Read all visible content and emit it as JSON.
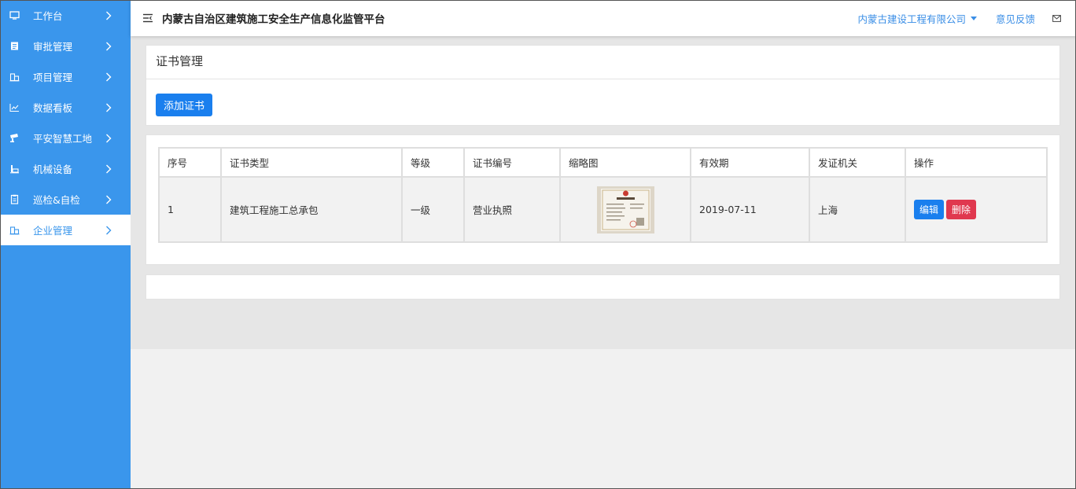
{
  "header": {
    "title": "内蒙古自治区建筑施工安全生产信息化监管平台",
    "company": "内蒙古建设工程有限公司",
    "feedback": "意见反馈"
  },
  "sidebar": {
    "items": [
      {
        "label": "工作台",
        "icon": "monitor-icon"
      },
      {
        "label": "审批管理",
        "icon": "document-icon"
      },
      {
        "label": "项目管理",
        "icon": "building-icon"
      },
      {
        "label": "数据看板",
        "icon": "chart-icon"
      },
      {
        "label": "平安智慧工地",
        "icon": "camera-icon"
      },
      {
        "label": "机械设备",
        "icon": "machine-icon"
      },
      {
        "label": "巡检&自检",
        "icon": "clipboard-icon"
      },
      {
        "label": "企业管理",
        "icon": "building-icon",
        "active": true
      }
    ]
  },
  "page": {
    "title": "证书管理",
    "add_button": "添加证书"
  },
  "table": {
    "headers": [
      "序号",
      "证书类型",
      "等级",
      "证书编号",
      "缩略图",
      "有效期",
      "发证机关",
      "操作"
    ],
    "rows": [
      {
        "index": "1",
        "type": "建筑工程施工总承包",
        "level": "一级",
        "number": "营业执照",
        "expiry": "2019-07-11",
        "authority": "上海",
        "edit_label": "编辑",
        "delete_label": "删除"
      }
    ]
  },
  "colors": {
    "sidebar": "#3a96ec",
    "primary": "#1a7fee",
    "danger": "#e0384f"
  }
}
